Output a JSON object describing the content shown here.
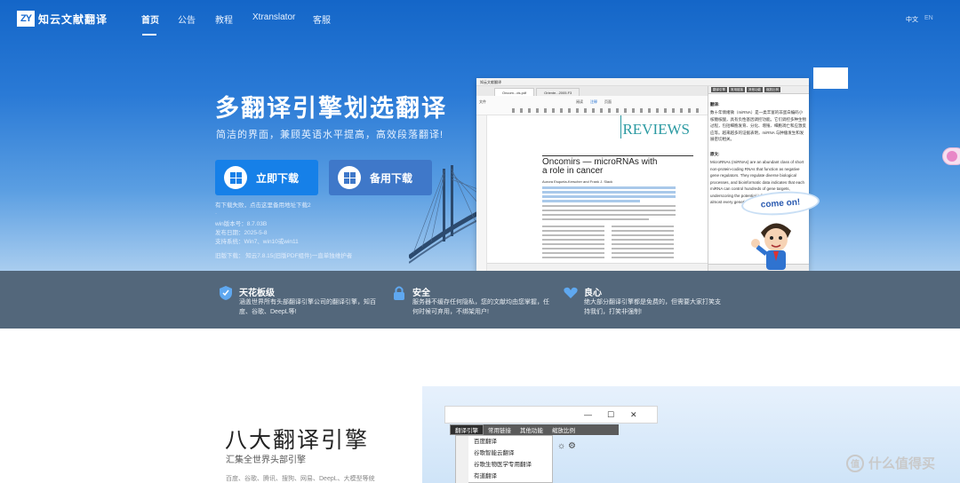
{
  "nav": {
    "logo_mark": "ZY",
    "logo_text": "知云文献翻译",
    "items": [
      {
        "label": "首页",
        "active": true
      },
      {
        "label": "公告"
      },
      {
        "label": "教程"
      },
      {
        "label": "Xtranslator"
      },
      {
        "label": "客服"
      }
    ],
    "lang_zh": "中文",
    "lang_en": "EN"
  },
  "hero": {
    "title": "多翻译引擎划选翻译",
    "subtitle": "简洁的界面，兼顾英语水平提高，高效段落翻译!",
    "primary_button": "立即下载",
    "secondary_button": "备用下载",
    "download_hint": "有下载失败，点击这里备用地址下载2",
    "version": "win版本号：8.7.03B",
    "release_date": "发布日期：2025-5-8",
    "systems": "支持系统：Win7、win10或win11",
    "old_version": "旧版下载：  知云7.8.15(旧版PDF组件)一直单独维护者"
  },
  "screenshot": {
    "window_title": "知云文献翻译",
    "tabs": [
      "Oncom...ds.pdf",
      "Oriente...2005.F3"
    ],
    "menus": [
      "文件",
      "阅读",
      "注释",
      "页面"
    ],
    "journal": "REVIEWS",
    "paper_title_line1": "Oncomirs — microRNAs with",
    "paper_title_line2": "a role in cancer",
    "authors": "Aurora Esquela-Kerscher and Frank J. Slack",
    "panel_tabs": [
      "翻译引擎",
      "常用链接",
      "其他功能",
      "缩放比例"
    ],
    "translate_label": "翻译:",
    "translation": "数十年情绪微（miRNA）是一类丰富的非蛋白编码小核糖核酸，具有负性基因调控功能。它们调控多种生物过程，包括细胞发育、分化、增殖、细胞凋亡和应激反应等。越来越多的证据表明，miRNA 与肿瘤发生和发展密切相关。",
    "original_label": "原文:",
    "original": "MicroRNAs (miRNAs) are an abundant class of short non-protein-coding RNAs that function as negative gene regulators. They regulate diverse biological processes, and bioinformatic data indicates that each miRNA can control hundreds of gene targets, underscoring the potential influence of miRNAs on almost every genetic pathway.",
    "come_on": "come on!"
  },
  "features": [
    {
      "title": "天花板级",
      "desc": "涵盖世界所有头部翻译引擎公司的翻译引擎，知百度、谷歌、DeepL等!"
    },
    {
      "title": "安全",
      "desc": "服务器不缓存任何隐私，您的文献均由您掌握，任何时候可弃用，不绑架用户!"
    },
    {
      "title": "良心",
      "desc": "绝大部分翻译引擎都是免费的，但需要大家打笑支持我们，打笑非强制!"
    }
  ],
  "section2": {
    "title": "八大翻译引擎",
    "subtitle": "汇集全世界头部引擎",
    "list": "百度、谷歌、腾讯、搜狗、网易、DeepL、大模型等统",
    "menubar": [
      "翻译引擎",
      "常用链接",
      "其他功能",
      "缩放比例"
    ],
    "dropdown": [
      "百度翻译",
      "谷歌智能云翻译",
      "谷歌生物医学专用翻译",
      "有道翻译"
    ]
  },
  "watermark": {
    "icon": "值",
    "text": "什么值得买"
  }
}
